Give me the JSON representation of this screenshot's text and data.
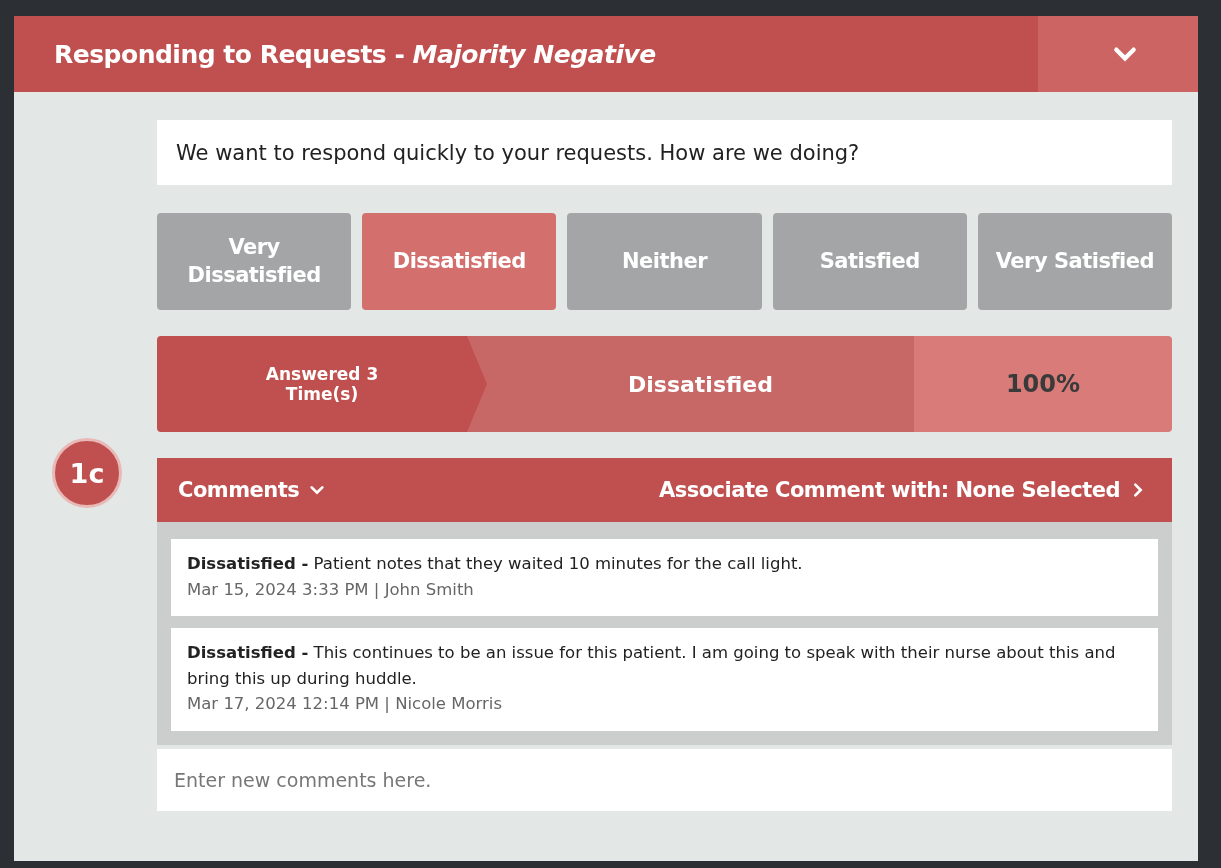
{
  "panel": {
    "title": "Responding to Requests - *Majority Negative*",
    "expanded": true
  },
  "question": "We want to respond quickly to your requests. How are we doing?",
  "choices": [
    {
      "label": "Very Dissatisfied",
      "selected": false
    },
    {
      "label": "Dissatisfied",
      "selected": true
    },
    {
      "label": "Neither",
      "selected": false
    },
    {
      "label": "Satisfied",
      "selected": false
    },
    {
      "label": "Very Satisfied",
      "selected": false
    }
  ],
  "result": {
    "answered": "Answered 3 Time(s)",
    "answer": "Dissatisfied",
    "percent": "100%"
  },
  "badge": "1c",
  "comments_header": {
    "label": "Comments",
    "expanded": true,
    "associate": "Associate Comment with: None Selected"
  },
  "comments": [
    {
      "rating": "Dissatisfied -",
      "text": "Patient notes that they waited 10 minutes for the call light.",
      "meta": "Mar 15, 2024 3:33 PM | John Smith"
    },
    {
      "rating": "Dissatisfied -",
      "text": "This continues to be an issue for this patient. I am going to speak with their nurse about this and bring this up during huddle.",
      "meta": "Mar 17, 2024 12:14 PM | Nicole Morris"
    }
  ],
  "new_comment": {
    "placeholder": "Enter new comments here."
  }
}
